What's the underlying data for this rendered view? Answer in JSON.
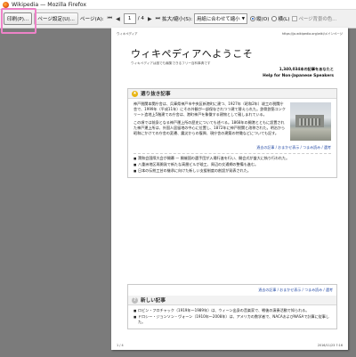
{
  "window": {
    "title": "Wikipedia — Mozilla Firefox"
  },
  "toolbar": {
    "print": "印刷(P)...",
    "page_setup": "ページ設定(U)...",
    "page_label": "ページ(A):",
    "current_page": "1",
    "of_pages": "/ 4",
    "zoom_label": "拡大/縮小(S):",
    "zoom_value": "用紙に合わせて縮小",
    "orient_portrait": "縦(O)",
    "orient_landscape": "横(L)",
    "bg_check": "ページ背景の色..."
  },
  "page": {
    "header_left": "ウィキペディア",
    "header_right": "https://ja.wikipedia.org/wiki/メインページ",
    "title": "ウィキペディアへようこそ",
    "subtitle": "ウィキペディアは誰でも編集できるフリー百科事典です",
    "article_count": "1,340,034本の記事をあなたと",
    "help_ns": "Help for Non-Japanese Speakers",
    "featured_title": "選り抜き記事",
    "featured_text": "神戸税関本関庁舎は、兵庫県神戸市中央区新港町に建つ、1927年（昭和2年）竣工の税関庁舎で、1999年（平成11年）にその外観が一部保存されつつ建て替えられた。鉄骨鉄筋コンクリート造地上5階建ての庁舎は、港町神戸を象徴する建物として親しまれている。",
    "featured_text2": "この項では前身となる神戸運上所の歴史についても述べる。1868年の開港とともに設置された神戸運上所は、外国人居留地の中心に位置し、1872年に神戸税関と改称された。明治から昭和にかけての庁舎の変遷、震災からの復興、現庁舎の建築の特徴などについても記す。",
    "featured_links": "過去の記事 / おまかせ表示 / つまみ読み / 選考",
    "news_items": [
      "潤和会国際大会が開幕 — 開催国の選手団が入場行進を行い、開会式が盛大に執り行われた。",
      "八重洲地区再開発で新たな高層ビルが竣工、周辺の交通網の整備も進む。",
      "日本の伝統工芸の継承に向けた新しい支援制度の創設が発表された。"
    ],
    "recent_title": "新しい記事",
    "recent_items": [
      "ロビン・フロチャック（1919年～1989年）は、ウィーン出身の音楽家で、戦後の演奏活動で知られる。",
      "ドロシー・ジョンソン・ヴォーン（1910年～2008年）は、アメリカの数学者で、NACAおよびNASAで計算に従事した。"
    ],
    "recent_links": "過去の記事 / おまかせ表示 / つまみ読み / 選考",
    "footer_left": "1 / 4",
    "footer_right": "2016/11/23 7:16"
  }
}
